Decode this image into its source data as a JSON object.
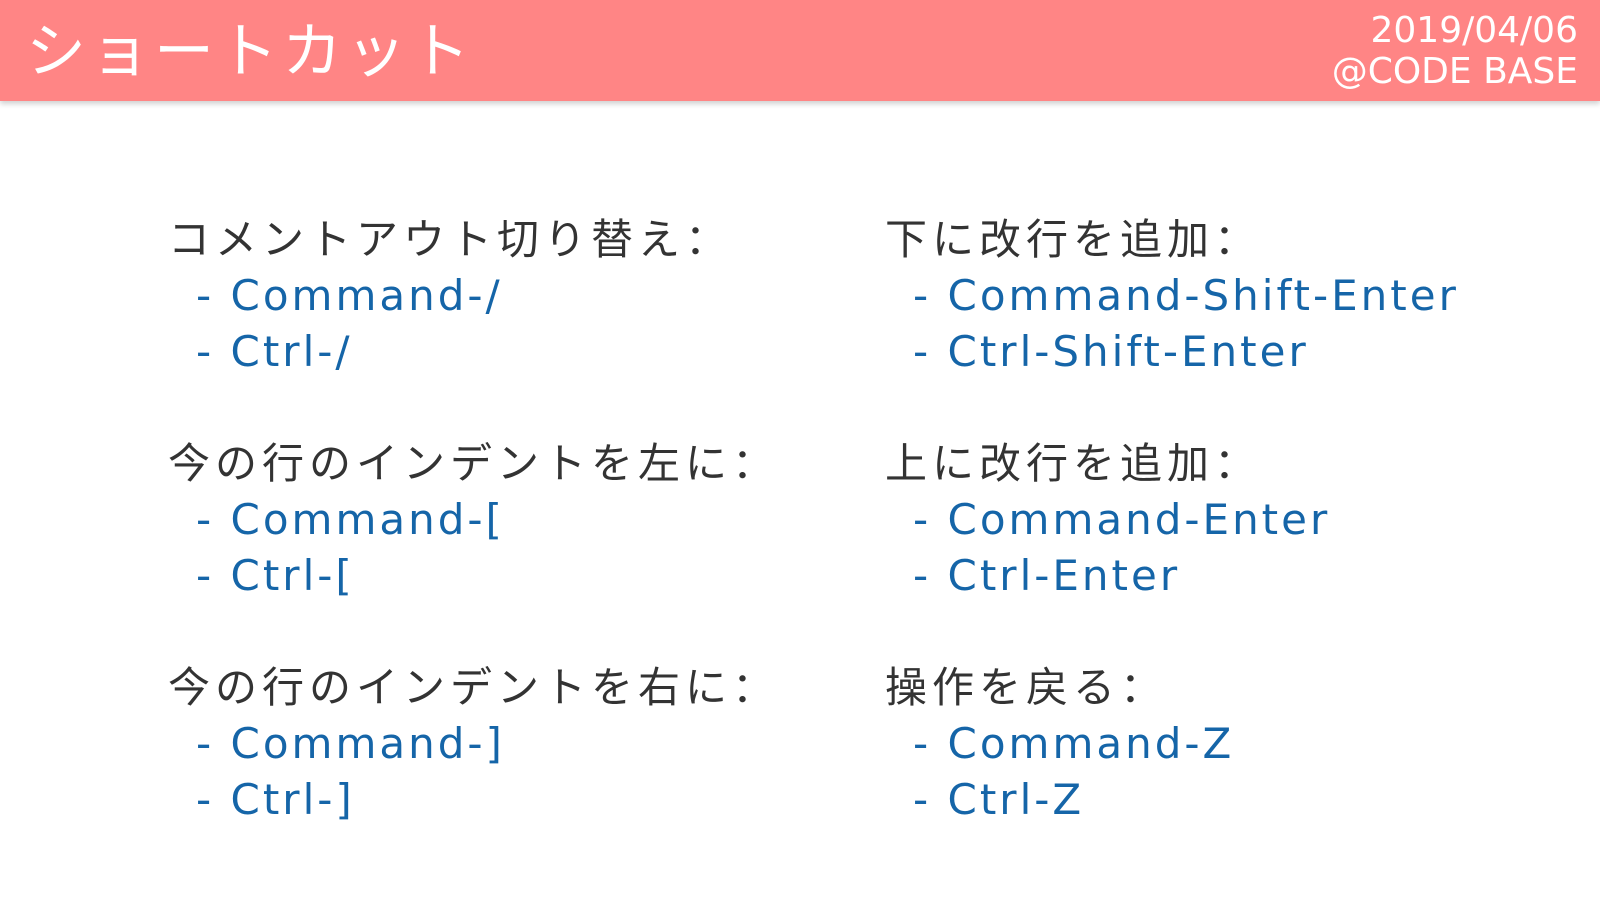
{
  "header": {
    "title": "ショートカット",
    "date": "2019/04/06",
    "author": "@CODE BASE",
    "background_color": "#ff8585"
  },
  "colors": {
    "title_text": "#333333",
    "shortcut_text": "#1565a8"
  },
  "left_column": [
    {
      "title": "コメントアウト切り替え：",
      "shortcuts": [
        "- Command-/",
        "- Ctrl-/"
      ]
    },
    {
      "title": "今の行のインデントを左に：",
      "shortcuts": [
        "- Command-[",
        "- Ctrl-["
      ]
    },
    {
      "title": "今の行のインデントを右に：",
      "shortcuts": [
        "- Command-]",
        "- Ctrl-]"
      ]
    }
  ],
  "right_column": [
    {
      "title": "下に改行を追加：",
      "shortcuts": [
        "- Command-Shift-Enter",
        "- Ctrl-Shift-Enter"
      ]
    },
    {
      "title": "上に改行を追加：",
      "shortcuts": [
        "- Command-Enter",
        "- Ctrl-Enter"
      ]
    },
    {
      "title": "操作を戻る：",
      "shortcuts": [
        "- Command-Z",
        "- Ctrl-Z"
      ]
    }
  ]
}
